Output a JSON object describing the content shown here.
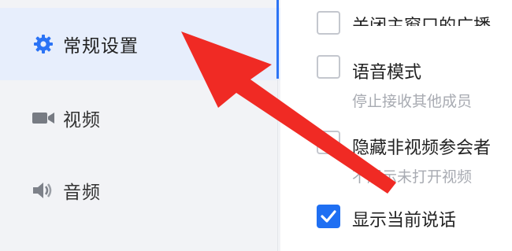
{
  "sidebar": {
    "items": [
      {
        "label": "常规设置",
        "icon": "gear-icon",
        "active": true
      },
      {
        "label": "视频",
        "icon": "video-camera-icon",
        "active": false
      },
      {
        "label": "音频",
        "icon": "speaker-icon",
        "active": false
      }
    ]
  },
  "content": {
    "options": [
      {
        "title": "关闭主窗口的广播",
        "checked": false
      },
      {
        "title": "语音模式",
        "subtitle": "停止接收其他成员",
        "checked": false
      },
      {
        "title": "隐藏非视频参会者",
        "subtitle": "不展示未打开视频",
        "checked": false
      },
      {
        "title": "显示当前说话",
        "checked": true
      }
    ]
  },
  "colors": {
    "accent": "#1f6ff2",
    "annotation_arrow": "#f02a24",
    "sidebar_bg": "#f2f3f6",
    "active_bg": "#e7eefc"
  }
}
